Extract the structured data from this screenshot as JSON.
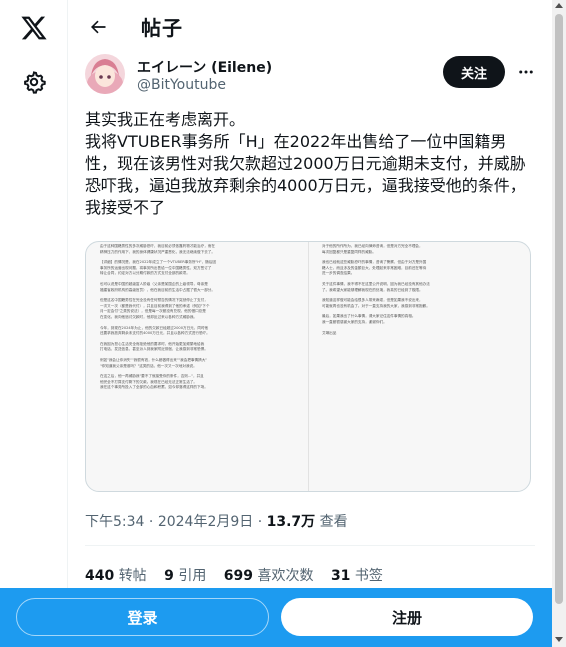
{
  "nav": {
    "logo_icon": "x-logo-icon",
    "settings_icon": "gear-icon"
  },
  "header": {
    "back_icon": "arrow-left-icon",
    "title": "帖子"
  },
  "author": {
    "display_name": "エイレーン (Eilene)",
    "handle": "@BitYoutube",
    "follow_label": "关注",
    "more_icon": "more-horizontal-icon"
  },
  "tweet": {
    "paragraphs": [
      "其实我正在考虑离开。",
      "我将VTUBER事务所「H」在2022年出售给了一位中国籍男性，现在该男性对我欠款超过2000万日元逾期未支付，并威胁恐吓我，逼迫我放弃剩余的4000万日元，逼我接受他的条件，我接受不了"
    ]
  },
  "media": {
    "left_lines": [
      "由于这种国籍男性的多次威胁恐吓，我目前必须依靠药物才能治疗，而在",
      "精神压力的作用下，我的身体健康状况严重恶化，我无法继续做下去了。",
      "",
      "【详细】的情况是，我在2022年成立了一个VTUBER事务所\"H\"，随后因",
      "事务所的运营出现问题，将事务所出售给一位中国籍男性，双方签订了",
      "转让合同，约定对方以分期付款的方式支付全部的款项。",
      "",
      "也可以说是中国的超级富人阶级（父亲是某国企的上级领导，母亲是",
      "福建省政府机构的高级官员），他在我目前的生活中占据了很大一部分。",
      "",
      "但是这名中国籍男性在完全没有任何预告的情况下突然停止了支付，",
      "一次又一次（都是我代付），并且目前我得到了他的承诺（例如\"下个",
      "月一定会付\"之类的说法），但是每一次都没有兑现，他的借口总是",
      "在变化。我向他追讨欠款时，他却反过来以各种方式威胁我。",
      "",
      "今年，到现在2024年为止，他的欠款已经超过2000万日元，同时他",
      "还要求我放弃剩余未支付的4000万日元，并且以各种方式进行恐吓。",
      "",
      "在我因为担心生活安全而拒绝他的要求时，他开始更加频繁地给我",
      "打电话、发送信息，甚至派人到我家附近徘徊，让我感到非常恐惧。",
      "",
      "例如\"我会让你消失\"\"我很有钱，什么都做得出来\"\"我会把事情搞大\"",
      "\"你知道我父亲是谁吗？\"这类的话，他一次又一次地对我说。",
      "",
      "在这之后，他一再威胁我\"要不了就接受你的条件，否则...\"，并且",
      "他完全不打算支付剩下的欠款。我现在已经无法正常生活了。",
      "我在这个事务所投入了全部的心血和积蓄，如今却落得这样的下场。"
    ],
    "right_lines": [
      "对于他的所作所为，我已经向律师咨询，但是对方完全不理会，",
      "每次回复都只是重复同样的威胁。",
      "",
      "我也已经就这些威胁恐吓的事情，咨询了警察，但由于对方是外国",
      "籍人士，而且涉及的金额巨大，处理起来非常困难，目前还在等待",
      "进一步的调查结果。",
      "",
      "关于这件事情，我不得不在这里公开说明，因为我已经没有其他办法",
      "了。我希望大家能够理解我现在的处境，我真的已经到了极限。",
      "",
      "我知道这样做可能会给很多人带来麻烦，但是如果我不说出来，",
      "可能就再也没有机会了。对于一直支持我的大家，我感到非常抱歉。",
      "",
      "最后，如果我出了什么事情，请大家记住这件事情的真相。",
      "我一直都很感谢大家的支持，谢谢你们。",
      "",
      "艾琳出品"
    ]
  },
  "meta": {
    "time": "下午5:34",
    "dot1": " · ",
    "date": "2024年2月9日",
    "dot2": " · ",
    "views_count": "13.7万",
    "views_label": " 查看"
  },
  "stats": {
    "reposts_count": "440",
    "reposts_label": "转帖",
    "quotes_count": "9",
    "quotes_label": "引用",
    "likes_count": "699",
    "likes_label": "喜欢次数",
    "bookmarks_count": "31",
    "bookmarks_label": "书签"
  },
  "bottom": {
    "login_label": "登录",
    "signup_label": "注册"
  },
  "colors": {
    "brand_blue": "#1d9bf0",
    "text_primary": "#0f1419",
    "text_secondary": "#536471",
    "border": "#eff3f4"
  }
}
